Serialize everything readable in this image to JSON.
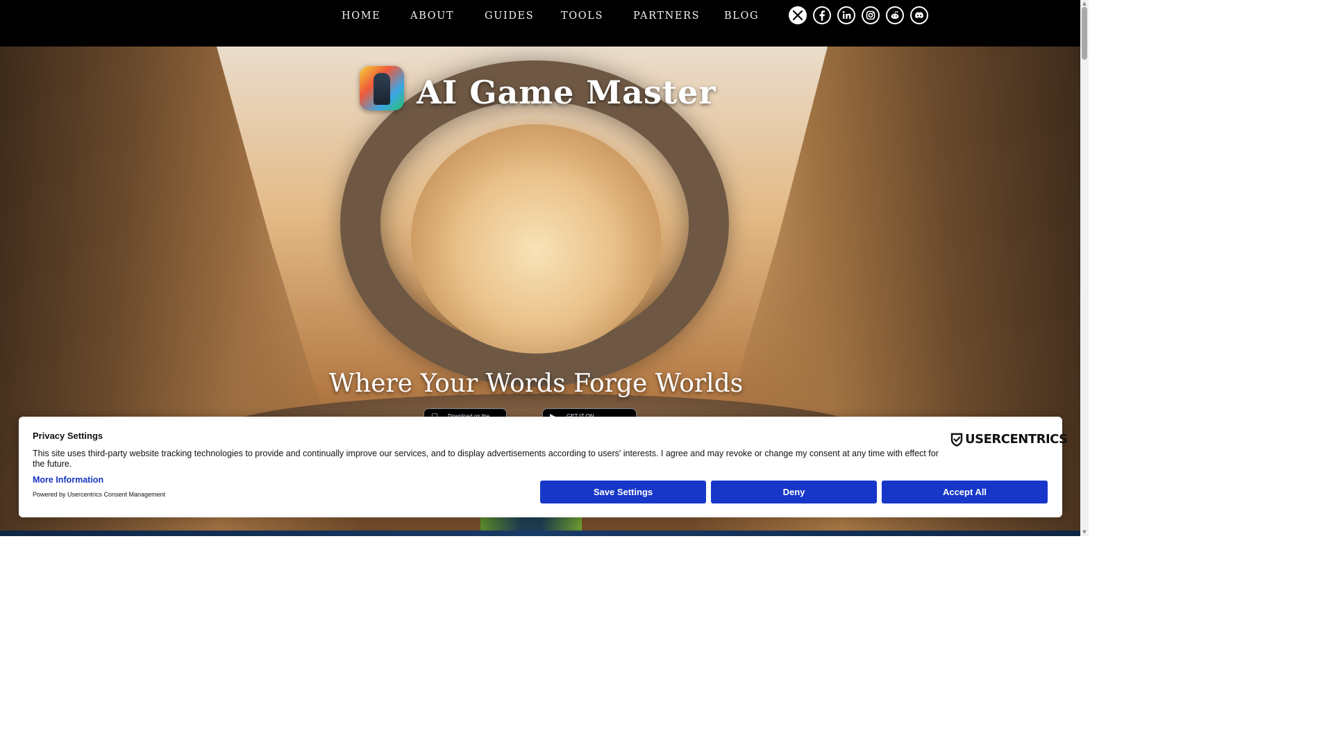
{
  "nav": {
    "links": [
      "HOME",
      "ABOUT",
      "GUIDES",
      "TOOLS",
      "PARTNERS",
      "BLOG"
    ],
    "socials": [
      "x-icon",
      "facebook-icon",
      "linkedin-icon",
      "instagram-icon",
      "reddit-icon",
      "discord-icon"
    ]
  },
  "hero": {
    "title": "AI Game Master",
    "tagline": "Where Your Words Forge Worlds",
    "app_store_label": "Download on the",
    "google_play_label": "GET IT ON"
  },
  "consent": {
    "title": "Privacy Settings",
    "text": "This site uses third-party website tracking technologies to provide and continually improve our services, and to display advertisements according to users' interests. I agree and may revoke or change my consent at any time with effect for the future.",
    "more_info": "More Information",
    "powered_by": "Powered by Usercentrics Consent Management",
    "logo_text": "USERCENTRICS",
    "buttons": {
      "save": "Save Settings",
      "deny": "Deny",
      "accept": "Accept All"
    }
  },
  "colors": {
    "nav_bg": "#000000",
    "consent_button": "#1637c8",
    "link_blue": "#1534c2"
  }
}
